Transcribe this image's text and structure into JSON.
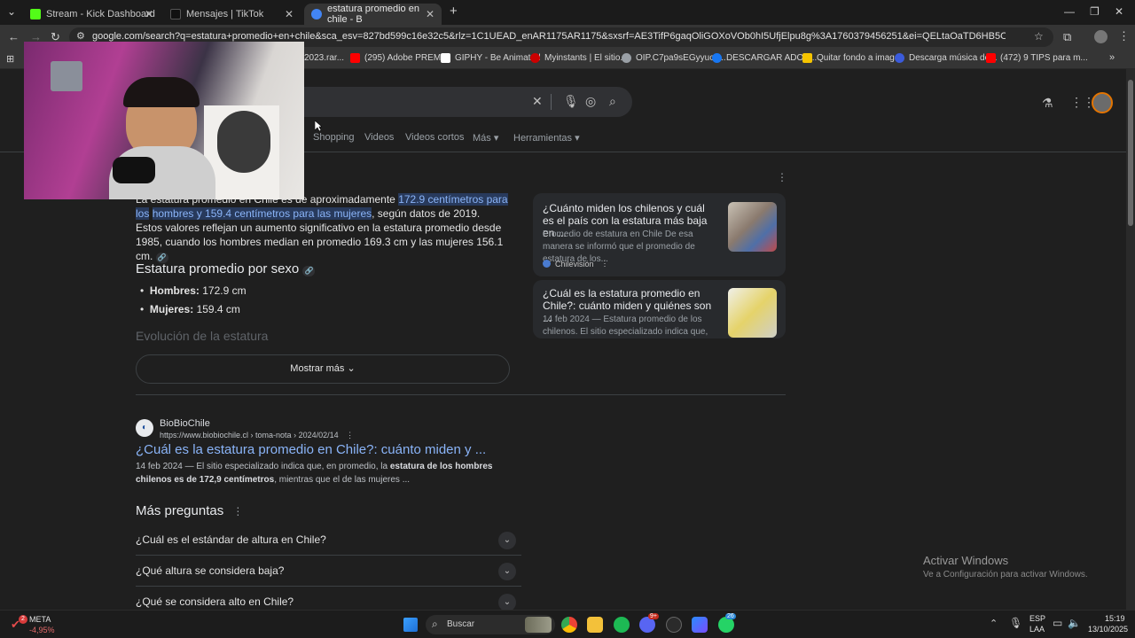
{
  "tabs": [
    {
      "label": "Stream - Kick Dashboard",
      "color": "#53fc18"
    },
    {
      "label": "Mensajes | TikTok",
      "color": "#111111"
    },
    {
      "label": "estatura promedio en chile - B",
      "color": "#4285f4"
    }
  ],
  "address": {
    "url": "google.com/search?q=estatura+promedio+en+chile&sca_esv=827bd599c16e32c5&rlz=1C1UEAD_enAR1175AR1175&sxsrf=AE3TifP6gaqOliGOXoVOb0hI5UfjElpu8g%3A1760379456251&ei=QELtaOaTD6HB5OUPxYm_6AQ&ved=0ahUKEwjms6PB5KGQAx..."
  },
  "bookmarks": [
    {
      "label": "2023.rar...",
      "color": "#7a7a7a"
    },
    {
      "label": "(295) Adobe PREMI...",
      "color": "#ff0000"
    },
    {
      "label": "GIPHY - Be Animated",
      "color": "#ffffff"
    },
    {
      "label": "Myinstants | El sitio...",
      "color": "#cc0000"
    },
    {
      "label": "OIP.C7pa9sEGyyucs...",
      "color": "#9aa0a6"
    },
    {
      "label": "DESCARGAR ADOB...",
      "color": "#1877f2"
    },
    {
      "label": "Quitar fondo a imag...",
      "color": "#f5c400"
    },
    {
      "label": "Descarga música de...",
      "color": "#3b5bdb"
    },
    {
      "label": "(472) 9 TIPS para m...",
      "color": "#ff0000"
    }
  ],
  "search_nav": [
    "Shopping",
    "Videos",
    "Videos cortos",
    "Más ▾",
    "Herramientas ▾"
  ],
  "overview": {
    "intro": "La estatura promedio en Chile es de aproximadamente",
    "highlight1": "172.9 centímetros para los",
    "highlight2": "hombres y 159.4 centímetros para las mujeres",
    "rest": ", según datos de 2019. Estos valores reflejan un aumento significativo en la estatura promedio desde 1985, cuando los hombres median en promedio 169.3 cm y las mujeres 156.1 cm.",
    "heading": "Estatura promedio por sexo",
    "bullets": [
      {
        "label": "Hombres:",
        "value": " 172.9 cm"
      },
      {
        "label": "Mujeres:",
        "value": " 159.4 cm"
      }
    ],
    "faded_heading": "Evolución de la estatura",
    "show_more": "Mostrar más"
  },
  "side_cards": [
    {
      "title": "¿Cuánto miden los chilenos y cuál es el país con la estatura más baja en ...",
      "snippet": "Promedio de estatura en Chile De esa manera se informó que el promedio de estatura de los...",
      "source": "Chilevisión"
    },
    {
      "title": "¿Cuál es la estatura promedio en Chile?: cuánto miden y quiénes son ...",
      "snippet": "14 feb 2024 — Estatura promedio de los chilenos. El sitio especializado indica que, en"
    }
  ],
  "result": {
    "site": "BioBioChile",
    "url": "https://www.biobiochile.cl › toma-nota › 2024/02/14",
    "title": "¿Cuál es la estatura promedio en Chile?: cuánto miden y ...",
    "snippet_a": "14 feb 2024 — El sitio especializado indica que, en promedio, la ",
    "snippet_bold": "estatura de los hombres chilenos es de 172,9 centímetros",
    "snippet_b": ", mientras que el de las mujeres ..."
  },
  "paa": {
    "heading": "Más preguntas",
    "items": [
      "¿Cuál es el estándar de altura en Chile?",
      "¿Qué altura se considera baja?",
      "¿Qué se considera alto en Chile?"
    ]
  },
  "watermark": {
    "title": "Activar Windows",
    "subtitle": "Ve a Configuración para activar Windows."
  },
  "taskbar": {
    "stock_name": "META",
    "stock_change": "-4,95%",
    "stock_badge": "2",
    "search": "Buscar",
    "lang1": "ESP",
    "lang2": "LAA",
    "time": "15:19",
    "date": "13/10/2025",
    "badge_discord": "9+",
    "badge_whatsapp": "26"
  }
}
